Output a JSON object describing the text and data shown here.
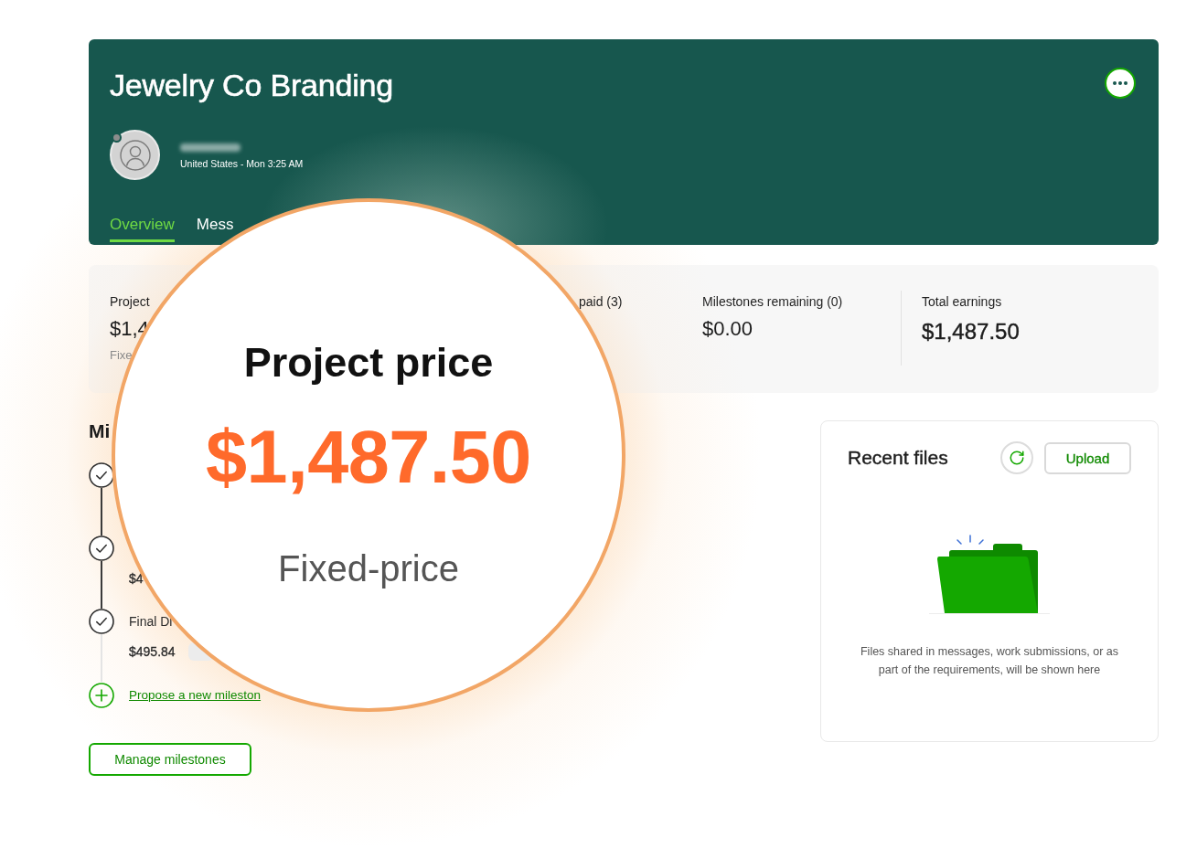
{
  "project": {
    "title": "Jewelry Co Branding"
  },
  "client": {
    "online": false,
    "location_time": "United States - Mon 3:25 AM"
  },
  "tabs": [
    {
      "label": "Overview",
      "selected": true
    },
    {
      "label": "Mess",
      "selected": false
    }
  ],
  "summary": [
    {
      "kind": "stat",
      "label": "Project",
      "value": "$1,4",
      "note": "Fixe"
    },
    {
      "kind": "stat",
      "label": "paid (3)"
    },
    {
      "kind": "stat",
      "label": "Milestones remaining (0)",
      "value": "$0.00"
    },
    {
      "kind": "total",
      "label": "Total earnings",
      "value": "$1,487.50"
    }
  ],
  "milestones": {
    "heading": "Mi",
    "items": [
      {
        "completed": true
      },
      {
        "completed": true,
        "amount": "$4"
      },
      {
        "completed": true,
        "title": "Final Di",
        "amount": "$495.84",
        "status_pill": true
      }
    ],
    "propose_link": "Propose a new mileston",
    "manage_button": "Manage milestones"
  },
  "recent_files": {
    "title": "Recent files",
    "upload_button": "Upload",
    "empty_message": "Files shared in messages, work submissions, or as part of the requirements, will be shown here"
  },
  "magnifier": {
    "title": "Project price",
    "amount": "$1,487.50",
    "price_type": "Fixed-price"
  }
}
